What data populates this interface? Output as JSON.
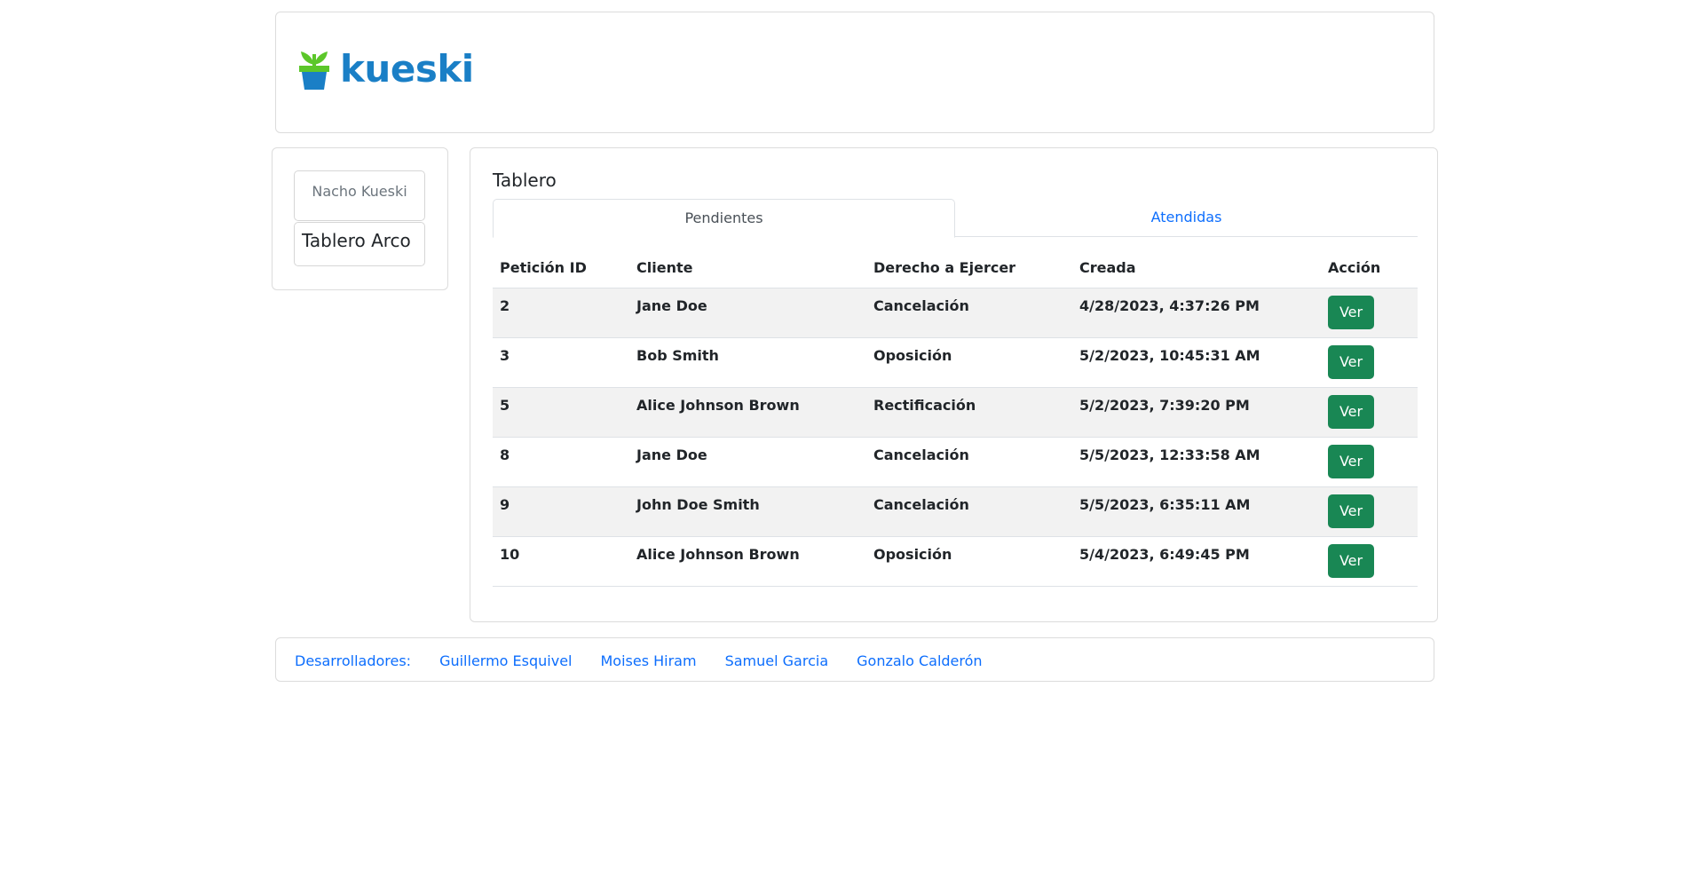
{
  "brand": {
    "name": "kueski",
    "color": "#1a7fc6",
    "icon": "plant-pot-icon"
  },
  "sidebar": {
    "user_name": "Nacho Kueski",
    "items": [
      {
        "label": "Tablero Arco"
      }
    ]
  },
  "main": {
    "title": "Tablero",
    "tabs": [
      {
        "label": "Pendientes",
        "active": true
      },
      {
        "label": "Atendidas",
        "active": false
      }
    ],
    "table": {
      "headers": [
        "Petición ID",
        "Cliente",
        "Derecho a Ejercer",
        "Creada",
        "Acción"
      ],
      "rows": [
        {
          "id": "2",
          "cliente": "Jane Doe",
          "derecho": "Cancelación",
          "creada": "4/28/2023, 4:37:26 PM",
          "accion": "Ver"
        },
        {
          "id": "3",
          "cliente": "Bob Smith",
          "derecho": "Oposición",
          "creada": "5/2/2023, 10:45:31 AM",
          "accion": "Ver"
        },
        {
          "id": "5",
          "cliente": "Alice Johnson Brown",
          "derecho": "Rectificación",
          "creada": "5/2/2023, 7:39:20 PM",
          "accion": "Ver"
        },
        {
          "id": "8",
          "cliente": "Jane Doe",
          "derecho": "Cancelación",
          "creada": "5/5/2023, 12:33:58 AM",
          "accion": "Ver"
        },
        {
          "id": "9",
          "cliente": "John Doe Smith",
          "derecho": "Cancelación",
          "creada": "5/5/2023, 6:35:11 AM",
          "accion": "Ver"
        },
        {
          "id": "10",
          "cliente": "Alice Johnson Brown",
          "derecho": "Oposición",
          "creada": "5/4/2023, 6:49:45 PM",
          "accion": "Ver"
        }
      ]
    }
  },
  "footer": {
    "label": "Desarrolladores:",
    "developers": [
      "Guillermo Esquivel",
      "Moises Hiram",
      "Samuel Garcia",
      "Gonzalo Calderón"
    ]
  },
  "colors": {
    "accent": "#0d6efd",
    "button": "#198754",
    "logo_green": "#5cc72a",
    "logo_blue": "#1a7fc6"
  }
}
